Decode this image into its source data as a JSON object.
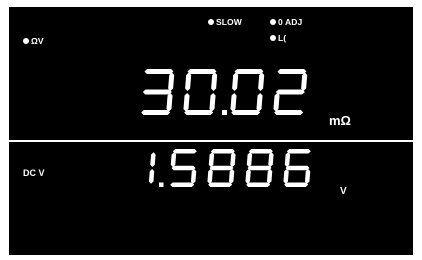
{
  "display": {
    "indicators": {
      "slow": "SLOW",
      "zero_adj": "0 ADJ",
      "lo": "L(",
      "mode": "ΩV"
    },
    "resistance": {
      "value": "30.02",
      "unit": "mΩ"
    },
    "voltage": {
      "label": "DC V",
      "value": "1.5886",
      "unit": "V"
    }
  },
  "colors": {
    "background": "#000000",
    "segment": "#ffffff"
  }
}
